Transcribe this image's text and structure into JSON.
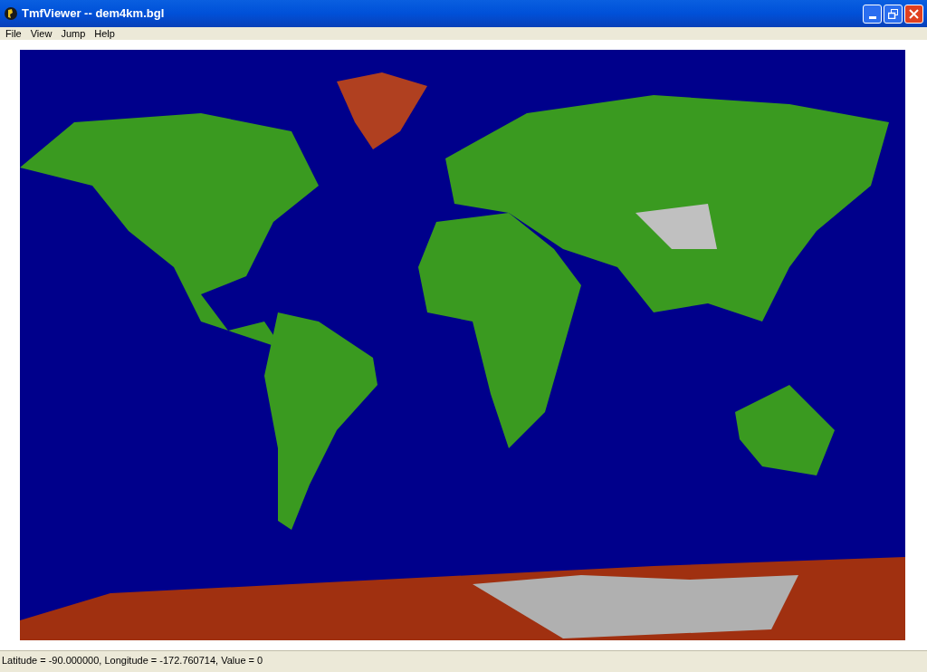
{
  "window": {
    "title": "TmfViewer -- dem4km.bgl"
  },
  "menu": [
    "File",
    "View",
    "Jump",
    "Help"
  ],
  "status_bar": "Latitude = -90.000000, Longitude = -172.760714, Value = 0"
}
